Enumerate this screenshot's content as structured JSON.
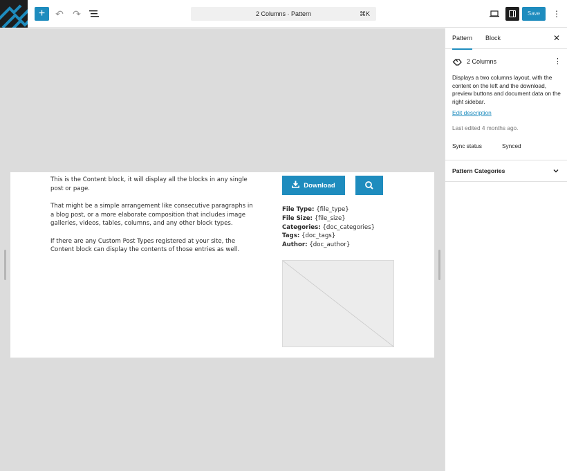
{
  "toolbar": {
    "add_label": "+",
    "command_title": "2 Columns · Pattern",
    "command_shortcut": "⌘K",
    "save_label": "Save",
    "more_label": "⋮"
  },
  "content": {
    "paragraphs": [
      "This is the Content block, it will display all the blocks in any single post or page.",
      "That might be a simple arrangement like consecutive paragraphs in a blog post, or a more elaborate composition that includes image galleries, videos, tables, columns, and any other block types.",
      "If there are any Custom Post Types registered at your site, the Content block can display the contents of those entries as well."
    ],
    "download_label": "Download",
    "meta": [
      {
        "label": "File Type:",
        "value": "{file_type}"
      },
      {
        "label": "File Size:",
        "value": "{file_size}"
      },
      {
        "label": "Categories:",
        "value": "{doc_categories}"
      },
      {
        "label": "Tags:",
        "value": "{doc_tags}"
      },
      {
        "label": "Author:",
        "value": "{doc_author}"
      }
    ]
  },
  "sidebar": {
    "tabs": [
      "Pattern",
      "Block"
    ],
    "close_label": "✕",
    "pattern_title": "2 Columns",
    "pattern_more": "⋮",
    "description": "Displays a two columns layout, with the content on the left and the download, preview buttons and document data on the right sidebar.",
    "edit_description": "Edit description",
    "last_edited": "Last edited 4 months ago.",
    "sync_status_label": "Sync status",
    "sync_status_value": "Synced",
    "categories_title": "Pattern Categories"
  },
  "colors": {
    "accent": "#1e8cbe",
    "canvas_bg": "#dcdcdc",
    "dark": "#1e1e1e"
  }
}
